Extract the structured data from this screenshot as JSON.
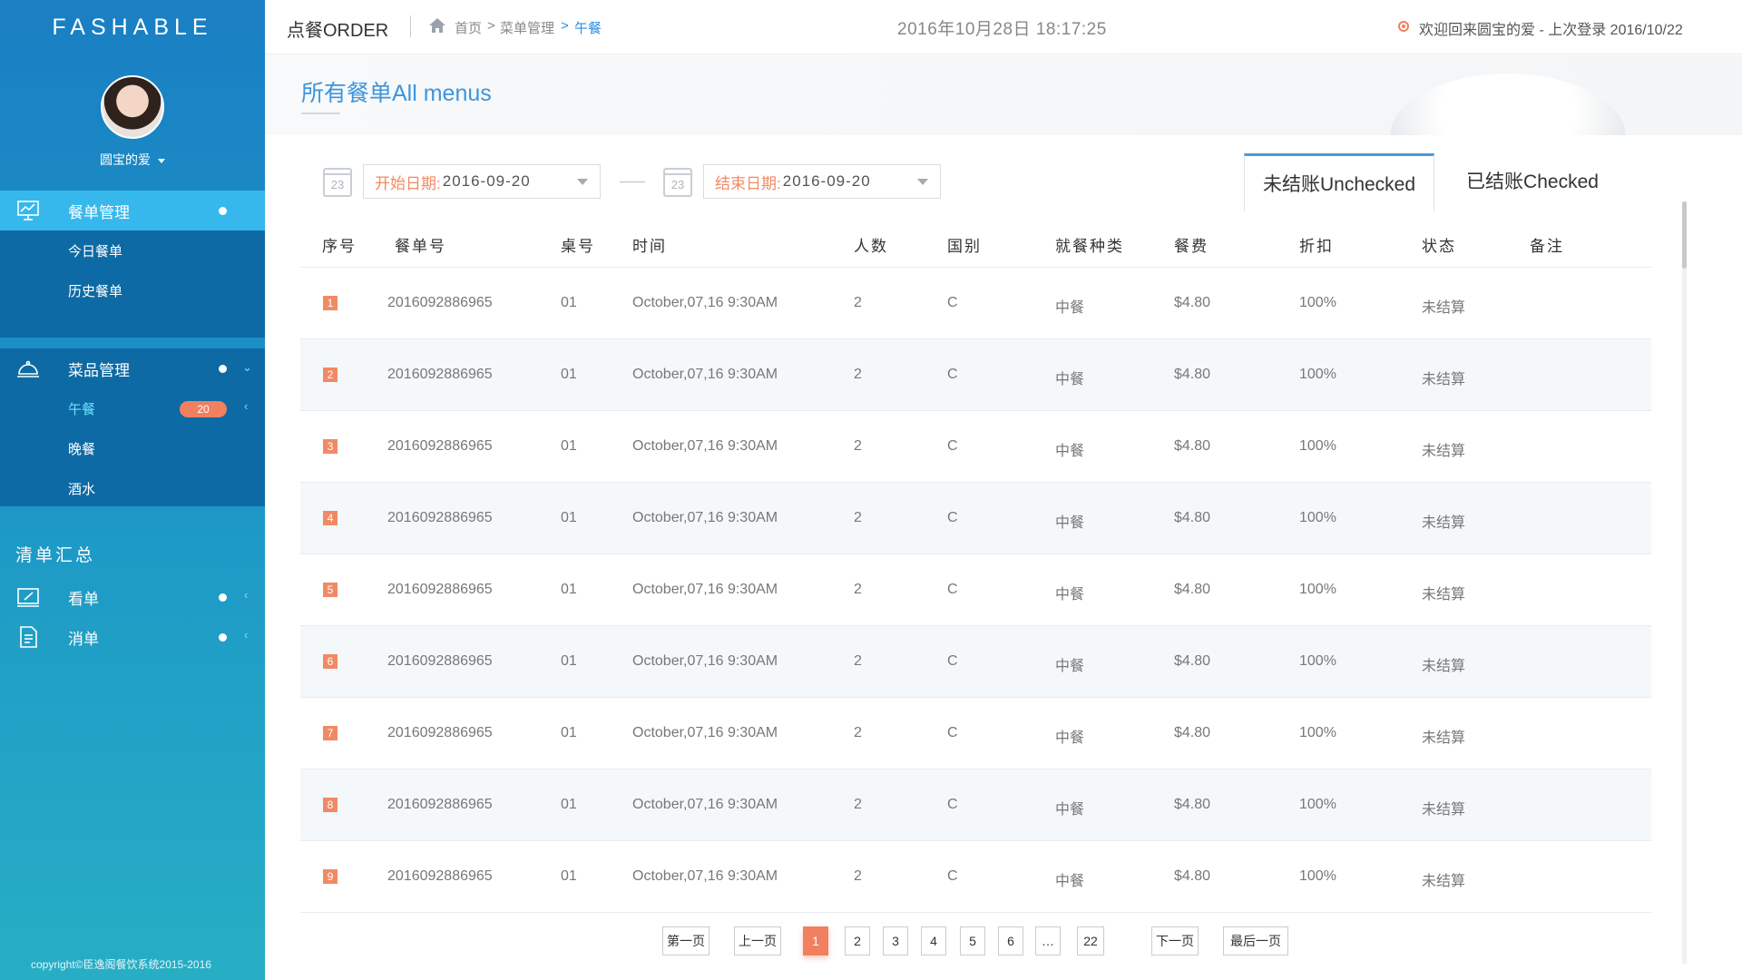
{
  "brand": "FASHABLE",
  "user": {
    "name": "圆宝的爱"
  },
  "nav": {
    "meal_mgmt": {
      "label": "餐单管理",
      "items": [
        "今日餐单",
        "历史餐单"
      ]
    },
    "dish_mgmt": {
      "label": "菜品管理",
      "items": [
        "午餐",
        "晚餐",
        "酒水"
      ],
      "lunch_badge": "20"
    },
    "summary_title": "清单汇总",
    "summary_items": [
      "看单",
      "消单"
    ]
  },
  "copyright": "copyright©臣逸阁餐饮系统2015-2016",
  "header": {
    "app_title": "点餐ORDER",
    "breadcrumb": [
      "首页",
      ">",
      "菜单管理",
      ">",
      "午餐"
    ],
    "datetime": "2016年10月28日 18:17:25",
    "welcome": "欢迎回来圆宝的爱 - 上次登录 2016/10/22"
  },
  "page": {
    "title": "所有餐单All menus"
  },
  "filters": {
    "cal_day": "23",
    "start_label": "开始日期:",
    "start_value": "2016-09-20",
    "end_label": "结束日期:",
    "end_value": "2016-09-20"
  },
  "tabs": {
    "unchecked": "未结账Unchecked",
    "checked": "已结账Checked"
  },
  "table": {
    "headers": [
      "序号",
      "餐单号",
      "桌号",
      "时间",
      "人数",
      "国别",
      "就餐种类",
      "餐费",
      "折扣",
      "状态",
      "备注"
    ],
    "rows": [
      [
        "1",
        "2016092886965",
        "01",
        "October,07,16 9:30AM",
        "2",
        "C",
        "中餐",
        "$4.80",
        "100%",
        "未结算",
        ""
      ],
      [
        "2",
        "2016092886965",
        "01",
        "October,07,16 9:30AM",
        "2",
        "C",
        "中餐",
        "$4.80",
        "100%",
        "未结算",
        ""
      ],
      [
        "3",
        "2016092886965",
        "01",
        "October,07,16 9:30AM",
        "2",
        "C",
        "中餐",
        "$4.80",
        "100%",
        "未结算",
        ""
      ],
      [
        "4",
        "2016092886965",
        "01",
        "October,07,16 9:30AM",
        "2",
        "C",
        "中餐",
        "$4.80",
        "100%",
        "未结算",
        ""
      ],
      [
        "5",
        "2016092886965",
        "01",
        "October,07,16 9:30AM",
        "2",
        "C",
        "中餐",
        "$4.80",
        "100%",
        "未结算",
        ""
      ],
      [
        "6",
        "2016092886965",
        "01",
        "October,07,16 9:30AM",
        "2",
        "C",
        "中餐",
        "$4.80",
        "100%",
        "未结算",
        ""
      ],
      [
        "7",
        "2016092886965",
        "01",
        "October,07,16 9:30AM",
        "2",
        "C",
        "中餐",
        "$4.80",
        "100%",
        "未结算",
        ""
      ],
      [
        "8",
        "2016092886965",
        "01",
        "October,07,16 9:30AM",
        "2",
        "C",
        "中餐",
        "$4.80",
        "100%",
        "未结算",
        ""
      ],
      [
        "9",
        "2016092886965",
        "01",
        "October,07,16 9:30AM",
        "2",
        "C",
        "中餐",
        "$4.80",
        "100%",
        "未结算",
        ""
      ]
    ]
  },
  "pagination": {
    "first": "第一页",
    "prev": "上一页",
    "pages": [
      "1",
      "2",
      "3",
      "4",
      "5",
      "6",
      "…",
      "22"
    ],
    "current": "1",
    "next": "下一页",
    "last": "最后一页"
  },
  "colors": {
    "accent": "#f08060",
    "sidebar_top": "#1a7fc3",
    "sidebar_bottom": "#27aec5",
    "title_blue": "#3d95dc"
  }
}
